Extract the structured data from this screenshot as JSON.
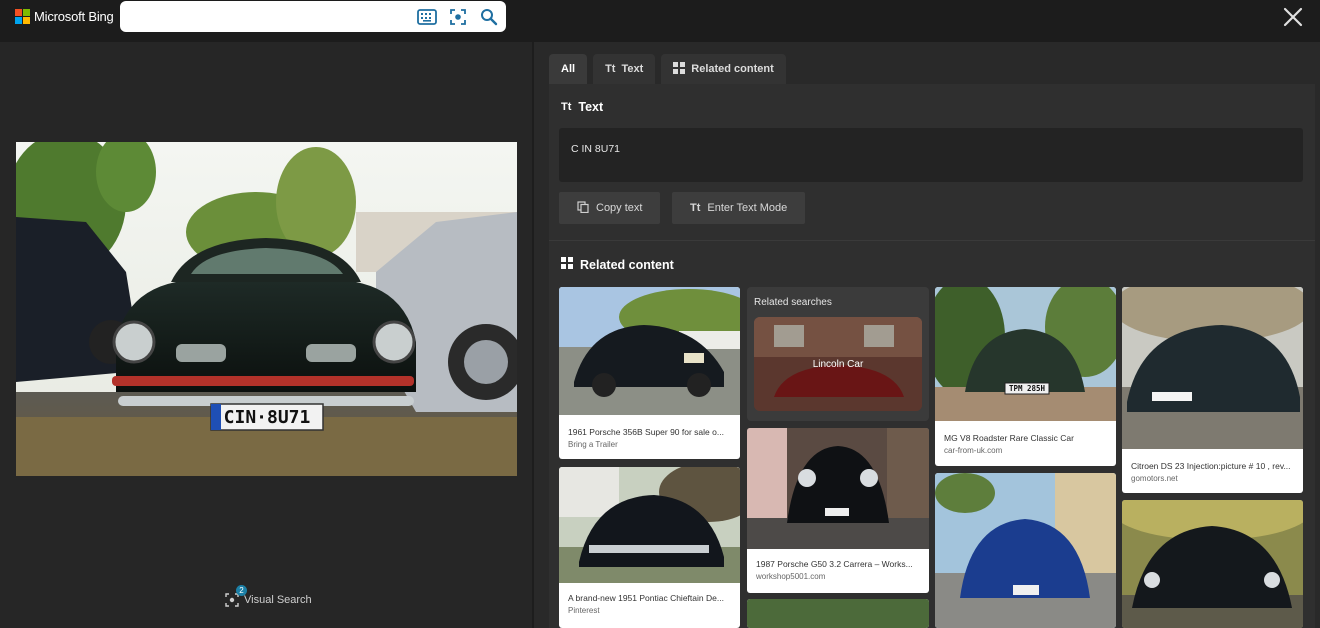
{
  "header": {
    "brand": "Microsoft Bing",
    "logo_colors": [
      "#f25022",
      "#7fba00",
      "#00a4ef",
      "#ffb900"
    ],
    "search": {
      "value": "",
      "placeholder": ""
    },
    "icons": [
      "keyboard-icon",
      "visual-search-icon",
      "search-icon",
      "close-icon"
    ]
  },
  "left": {
    "photo_plate": "CIN·8U71",
    "visual_search_label": "Visual Search",
    "visual_search_count": "2"
  },
  "tabs": [
    {
      "label": "All",
      "active": true
    },
    {
      "label": "Text",
      "icon": "text-icon"
    },
    {
      "label": "Related content",
      "icon": "grid-icon"
    }
  ],
  "text_section": {
    "title": "Text",
    "extracted": "C IN 8U71",
    "copy_label": "Copy text",
    "enter_mode_label": "Enter Text Mode"
  },
  "related": {
    "title": "Related content",
    "cards": [
      {
        "caption": "1961 Porsche 356B Super 90 for sale o...",
        "source": "Bring a Trailer",
        "plate": ""
      },
      {
        "caption": "A brand-new 1951 Pontiac Chieftain De...",
        "source": "Pinterest"
      },
      {
        "caption": "1987 Porsche G50 3.2 Carrera – Works...",
        "source": "workshop5001.com"
      },
      {
        "caption": "MG V8 Roadster Rare Classic Car",
        "source": "car-from-uk.com",
        "plate": "TPM 285H"
      },
      {
        "caption": "Citroen DS 23 Injection:picture # 10 , rev...",
        "source": "gomotors.net"
      }
    ],
    "related_searches": {
      "title": "Related searches",
      "item": "Lincoln Car"
    }
  }
}
